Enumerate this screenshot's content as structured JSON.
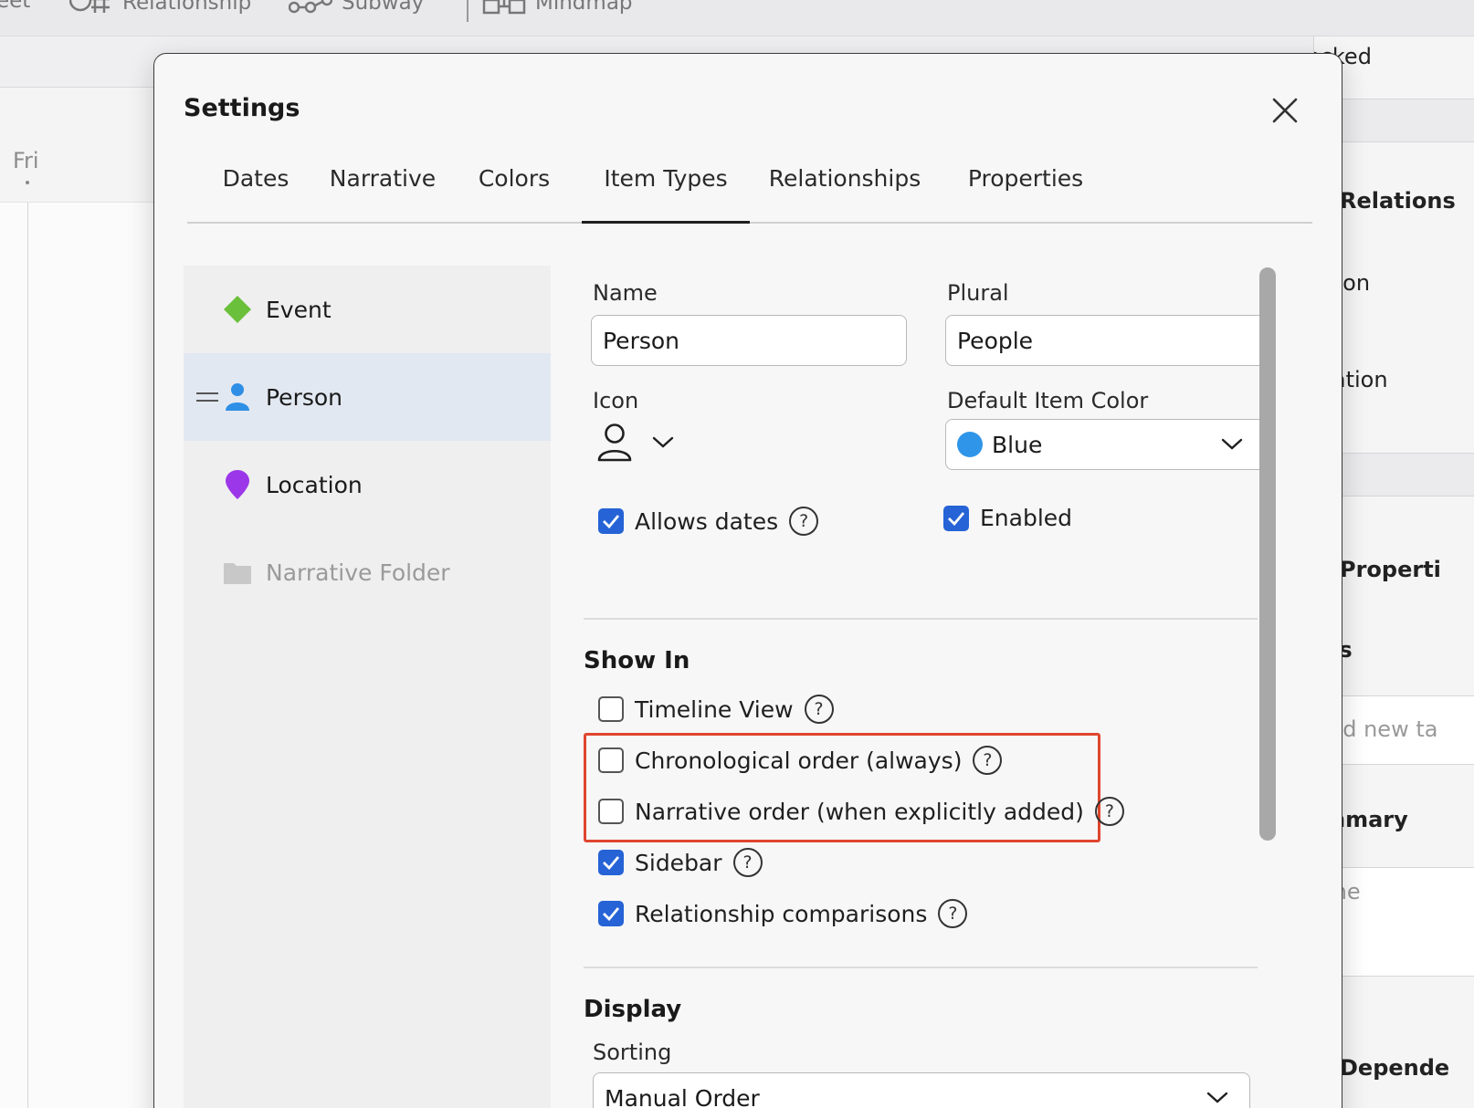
{
  "toolbar": {
    "items": [
      {
        "label": "eet",
        "icon": "sheet-icon"
      },
      {
        "label": "Relationship",
        "icon": "relationship-icon"
      },
      {
        "label": "Subway",
        "icon": "subway-icon"
      },
      {
        "label": "Mindmap",
        "icon": "mindmap-icon"
      }
    ]
  },
  "calendar": {
    "day_label": "Fri"
  },
  "right_panel": {
    "locked": "ocked",
    "relationships_title": "Relations",
    "person": "erson",
    "location": "ocation",
    "properties_title": "Properti",
    "tags_label": "ags",
    "tags_placeholder": "Add new ta",
    "summary_label": "ummary",
    "summary_value": "None",
    "dependencies_title": "Depende"
  },
  "dialog": {
    "title": "Settings",
    "tabs": [
      {
        "label": "Dates",
        "active": false
      },
      {
        "label": "Narrative",
        "active": false
      },
      {
        "label": "Colors",
        "active": false
      },
      {
        "label": "Item Types",
        "active": true
      },
      {
        "label": "Relationships",
        "active": false
      },
      {
        "label": "Properties",
        "active": false
      }
    ],
    "item_types": [
      {
        "label": "Event",
        "icon": "diamond-icon",
        "color": "#6abf3b",
        "selected": false,
        "muted": false
      },
      {
        "label": "Person",
        "icon": "person-icon",
        "color": "#2f8fe6",
        "selected": true,
        "muted": false
      },
      {
        "label": "Location",
        "icon": "map-pin-icon",
        "color": "#9b37e8",
        "selected": false,
        "muted": false
      },
      {
        "label": "Narrative Folder",
        "icon": "folder-icon",
        "color": "#c8c8c8",
        "selected": false,
        "muted": true
      }
    ],
    "form": {
      "name_label": "Name",
      "name_value": "Person",
      "plural_label": "Plural",
      "plural_value": "People",
      "icon_label": "Icon",
      "icon_value": "person-outline-icon",
      "color_label": "Default Item Color",
      "color_value": "Blue",
      "color_swatch": "#2f95e8",
      "allows_dates_label": "Allows dates",
      "allows_dates_checked": true,
      "enabled_label": "Enabled",
      "enabled_checked": true
    },
    "show_in": {
      "title": "Show In",
      "options": [
        {
          "label": "Timeline View",
          "checked": false
        },
        {
          "label": "Chronological order (always)",
          "checked": false
        },
        {
          "label": "Narrative order (when explicitly added)",
          "checked": false
        },
        {
          "label": "Sidebar",
          "checked": true
        },
        {
          "label": "Relationship comparisons",
          "checked": true
        }
      ]
    },
    "display": {
      "title": "Display",
      "sorting_label": "Sorting",
      "sorting_value": "Manual Order"
    },
    "help_glyph": "?",
    "accent_color": "#2563d6",
    "highlight_color": "#e0462e"
  }
}
